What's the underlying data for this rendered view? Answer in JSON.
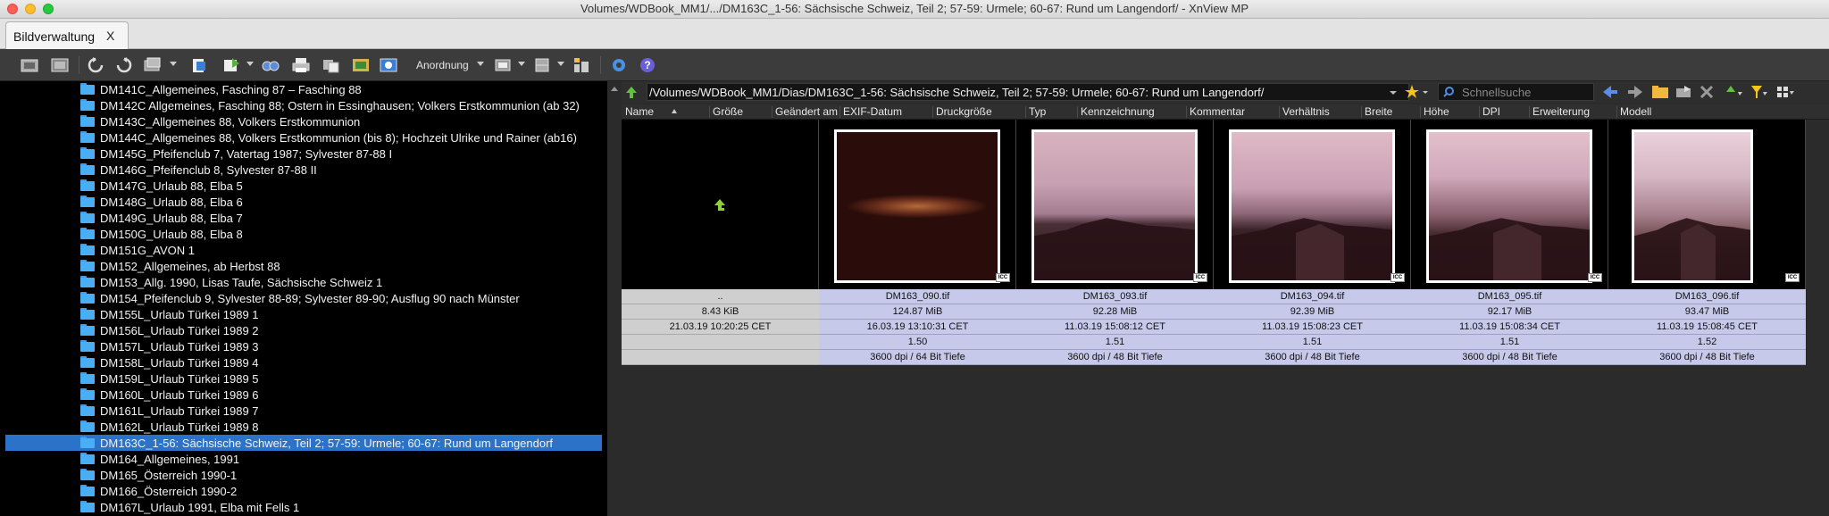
{
  "window": {
    "title": "Volumes/WDBook_MM1/.../DM163C_1-56: Sächsische Schweiz, Teil 2; 57-59: Urmele; 60-67: Rund um Langendorf/ - XnView MP"
  },
  "tabs": [
    {
      "label": "Bildverwaltung",
      "close": "X"
    }
  ],
  "toolbar": {
    "arrange_label": "Anordnung"
  },
  "tree": {
    "items": [
      {
        "label": "DM141C_Allgemeines, Fasching 87 – Fasching 88",
        "selected": false
      },
      {
        "label": "DM142C Allgemeines, Fasching 88; Ostern in Essinghausen; Volkers Erstkommunion (ab 32)",
        "selected": false
      },
      {
        "label": "DM143C_Allgemeines 88, Volkers Erstkommunion",
        "selected": false
      },
      {
        "label": "DM144C_Allgemeines 88, Volkers Erstkommunion (bis 8); Hochzeit Ulrike und Rainer (ab16)",
        "selected": false
      },
      {
        "label": "DM145G_Pfeifenclub 7, Vatertag 1987; Sylvester 87-88 I",
        "selected": false
      },
      {
        "label": "DM146G_Pfeifenclub 8, Sylvester 87-88 II",
        "selected": false
      },
      {
        "label": "DM147G_Urlaub 88, Elba 5",
        "selected": false
      },
      {
        "label": "DM148G_Urlaub 88, Elba 6",
        "selected": false
      },
      {
        "label": "DM149G_Urlaub 88, Elba 7",
        "selected": false
      },
      {
        "label": "DM150G_Urlaub 88, Elba 8",
        "selected": false
      },
      {
        "label": "DM151G_AVON 1",
        "selected": false
      },
      {
        "label": "DM152_Allgemeines, ab Herbst 88",
        "selected": false
      },
      {
        "label": "DM153_Allg. 1990, Lisas Taufe, Sächsische Schweiz 1",
        "selected": false
      },
      {
        "label": "DM154_Pfeifenclub 9, Sylvester 88-89; Sylvester 89-90; Ausflug 90 nach Münster",
        "selected": false
      },
      {
        "label": "DM155L_Urlaub Türkei 1989 1",
        "selected": false
      },
      {
        "label": "DM156L_Urlaub Türkei 1989 2",
        "selected": false
      },
      {
        "label": "DM157L_Urlaub Türkei 1989 3",
        "selected": false
      },
      {
        "label": "DM158L_Urlaub Türkei 1989 4",
        "selected": false
      },
      {
        "label": "DM159L_Urlaub Türkei 1989 5",
        "selected": false
      },
      {
        "label": "DM160L_Urlaub Türkei 1989 6",
        "selected": false
      },
      {
        "label": "DM161L_Urlaub Türkei 1989 7",
        "selected": false
      },
      {
        "label": "DM162L_Urlaub Türkei 1989 8",
        "selected": false
      },
      {
        "label": "DM163C_1-56: Sächsische Schweiz, Teil 2; 57-59: Urmele; 60-67: Rund um Langendorf",
        "selected": true
      },
      {
        "label": "DM164_Allgemeines, 1991",
        "selected": false
      },
      {
        "label": "DM165_Österreich 1990-1",
        "selected": false
      },
      {
        "label": "DM166_Österreich 1990-2",
        "selected": false
      },
      {
        "label": "DM167L_Urlaub 1991, Elba mit Fells 1",
        "selected": false
      }
    ]
  },
  "address": {
    "path": "/Volumes/WDBook_MM1/Dias/DM163C_1-56: Sächsische Schweiz, Teil 2; 57-59: Urmele; 60-67: Rund um Langendorf/",
    "search_placeholder": "Schnellsuche"
  },
  "columns": [
    "Name",
    "Größe",
    "Geändert am",
    "EXIF-Datum",
    "Druckgröße",
    "Typ",
    "Kennzeichnung",
    "Kommentar",
    "Verhältnis",
    "Breite",
    "Höhe",
    "DPI",
    "Erweiterung",
    "Modell"
  ],
  "files": [
    {
      "name": "..",
      "size": "8.43 KiB",
      "date": "21.03.19 10:20:25 CET",
      "ratio": "",
      "dpi": "",
      "is_parent": true
    },
    {
      "name": "DM163_090.tif",
      "size": "124.87 MiB",
      "date": "16.03.19 13:10:31 CET",
      "ratio": "1.50",
      "dpi": "3600 dpi / 64 Bit Tiefe",
      "is_parent": false,
      "icc": "ICC"
    },
    {
      "name": "DM163_093.tif",
      "size": "92.28 MiB",
      "date": "11.03.19 15:08:12 CET",
      "ratio": "1.51",
      "dpi": "3600 dpi / 48 Bit Tiefe",
      "is_parent": false,
      "icc": "ICC"
    },
    {
      "name": "DM163_094.tif",
      "size": "92.39 MiB",
      "date": "11.03.19 15:08:23 CET",
      "ratio": "1.51",
      "dpi": "3600 dpi / 48 Bit Tiefe",
      "is_parent": false,
      "icc": "ICC"
    },
    {
      "name": "DM163_095.tif",
      "size": "92.17 MiB",
      "date": "11.03.19 15:08:34 CET",
      "ratio": "1.51",
      "dpi": "3600 dpi / 48 Bit Tiefe",
      "is_parent": false,
      "icc": "ICC"
    },
    {
      "name": "DM163_096.tif",
      "size": "93.47 MiB",
      "date": "11.03.19 15:08:45 CET",
      "ratio": "1.52",
      "dpi": "3600 dpi / 48 Bit Tiefe",
      "is_parent": false,
      "icc": "ICC"
    }
  ],
  "colors": {
    "selection": "#2a73c8",
    "folder": "#4aaef5",
    "info_bg": "#c6c9ea",
    "parent_info_bg": "#cfcfcf"
  }
}
